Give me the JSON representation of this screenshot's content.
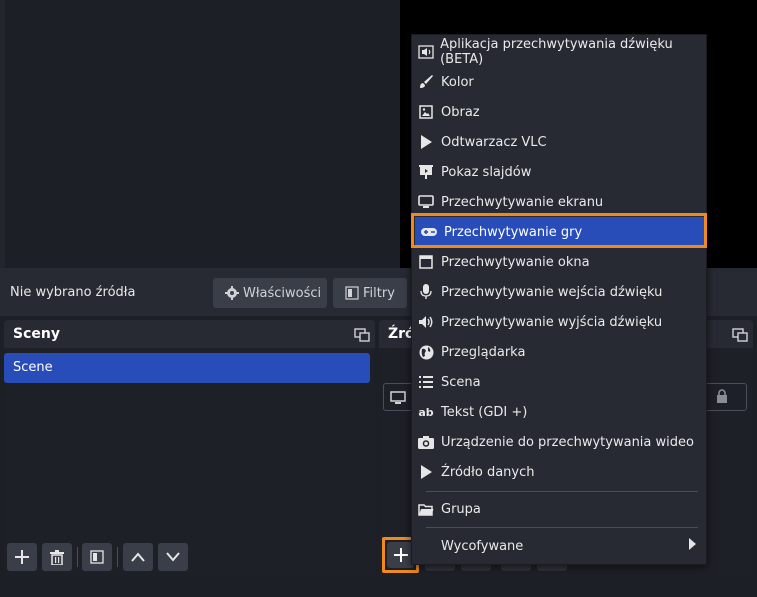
{
  "toolbar": {
    "no_source": "Nie wybrano źródła",
    "properties": "Właściwości",
    "filters": "Filtry"
  },
  "scenes": {
    "title": "Sceny",
    "items": [
      "Scene"
    ]
  },
  "sources": {
    "title_partial": "Źró"
  },
  "menu": {
    "items": [
      {
        "label": "Aplikacja przechwytywania dźwięku (BETA)",
        "icon": "speaker-icon"
      },
      {
        "label": "Kolor",
        "icon": "brush-icon"
      },
      {
        "label": "Obraz",
        "icon": "image-icon"
      },
      {
        "label": "Odtwarzacz VLC",
        "icon": "play-icon"
      },
      {
        "label": "Pokaz slajdów",
        "icon": "slideshow-icon"
      },
      {
        "label": "Przechwytywanie ekranu",
        "icon": "monitor-icon"
      },
      {
        "label": "Przechwytywanie gry",
        "icon": "gamepad-icon"
      },
      {
        "label": "Przechwytywanie okna",
        "icon": "window-icon"
      },
      {
        "label": "Przechwytywanie wejścia dźwięku",
        "icon": "microphone-icon"
      },
      {
        "label": "Przechwytywanie wyjścia dźwięku",
        "icon": "speaker-icon"
      },
      {
        "label": "Przeglądarka",
        "icon": "globe-icon"
      },
      {
        "label": "Scena",
        "icon": "list-icon"
      },
      {
        "label": "Tekst (GDI +)",
        "icon": "text-icon"
      },
      {
        "label": "Urządzenie do przechwytywania wideo",
        "icon": "camera-icon"
      },
      {
        "label": "Źródło danych",
        "icon": "play-icon"
      }
    ],
    "group": "Grupa",
    "deprecated": "Wycofywane"
  },
  "colors": {
    "accent": "#284cb8",
    "highlight": "#f08a1e"
  }
}
